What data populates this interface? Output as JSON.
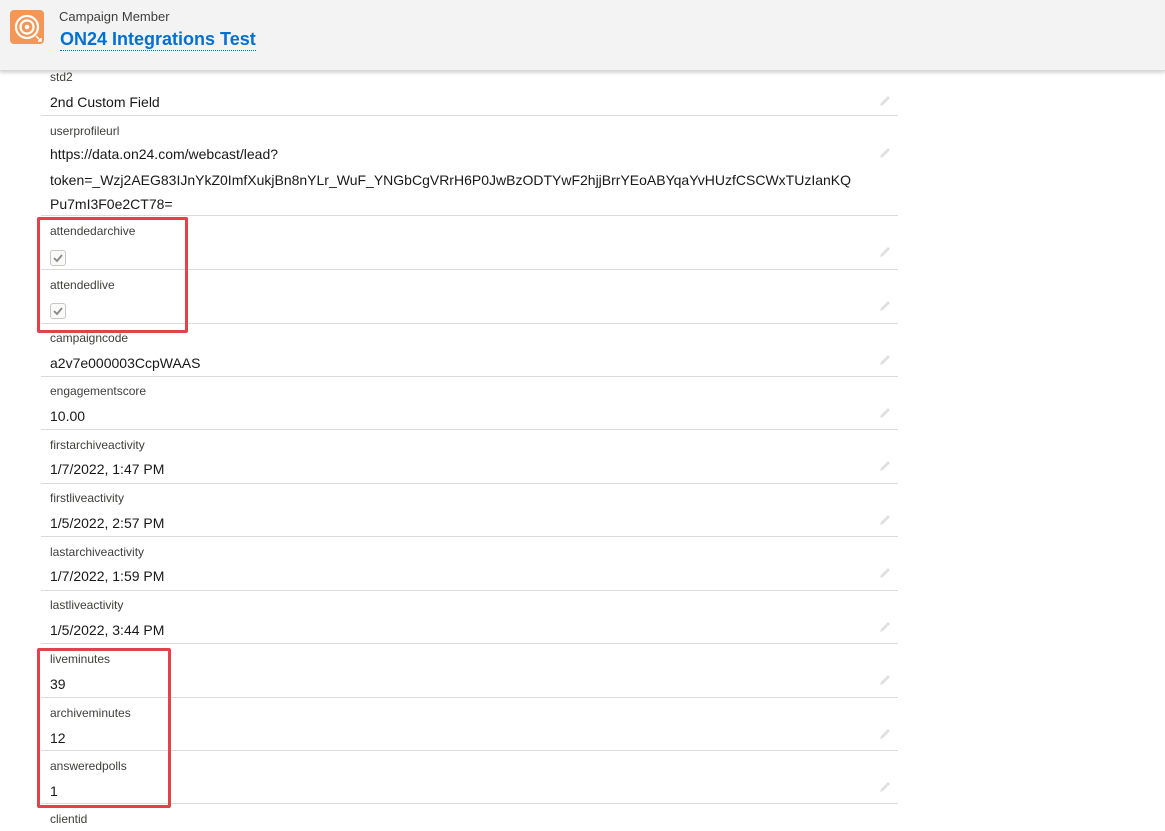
{
  "header": {
    "object_type": "Campaign Member",
    "record_title": "ON24 Integrations Test",
    "icon": "campaign-target-icon",
    "icon_color": "#f49756"
  },
  "fields": {
    "std2": {
      "label": "std2",
      "value": "2nd Custom Field"
    },
    "userprofileurl": {
      "label": "userprofileurl",
      "value_line1": "https://data.on24.com/webcast/lead?",
      "value_line2": "token=_Wzj2AEG83IJnYkZ0ImfXukjBn8nYLr_WuF_YNGbCgVRrH6P0JwBzODTYwF2hjjBrrYEoABYqaYvHUzfCSCWxTUzIanKQ",
      "value_line3": "Pu7mI3F0e2CT78="
    },
    "attendedarchive": {
      "label": "attendedarchive",
      "checked": true
    },
    "attendedlive": {
      "label": "attendedlive",
      "checked": true
    },
    "campaigncode": {
      "label": "campaigncode",
      "value": "a2v7e000003CcpWAAS"
    },
    "engagementscore": {
      "label": "engagementscore",
      "value": "10.00"
    },
    "firstarchiveactivity": {
      "label": "firstarchiveactivity",
      "value": "1/7/2022, 1:47 PM"
    },
    "firstliveactivity": {
      "label": "firstliveactivity",
      "value": "1/5/2022, 2:57 PM"
    },
    "lastarchiveactivity": {
      "label": "lastarchiveactivity",
      "value": "1/7/2022, 1:59 PM"
    },
    "lastliveactivity": {
      "label": "lastliveactivity",
      "value": "1/5/2022, 3:44 PM"
    },
    "liveminutes": {
      "label": "liveminutes",
      "value": "39"
    },
    "archiveminutes": {
      "label": "archiveminutes",
      "value": "12"
    },
    "answeredpolls": {
      "label": "answeredpolls",
      "value": "1"
    },
    "clientid": {
      "label": "clientid"
    }
  },
  "colors": {
    "highlight_box": "#e4424b",
    "link_blue": "#0070d2"
  }
}
